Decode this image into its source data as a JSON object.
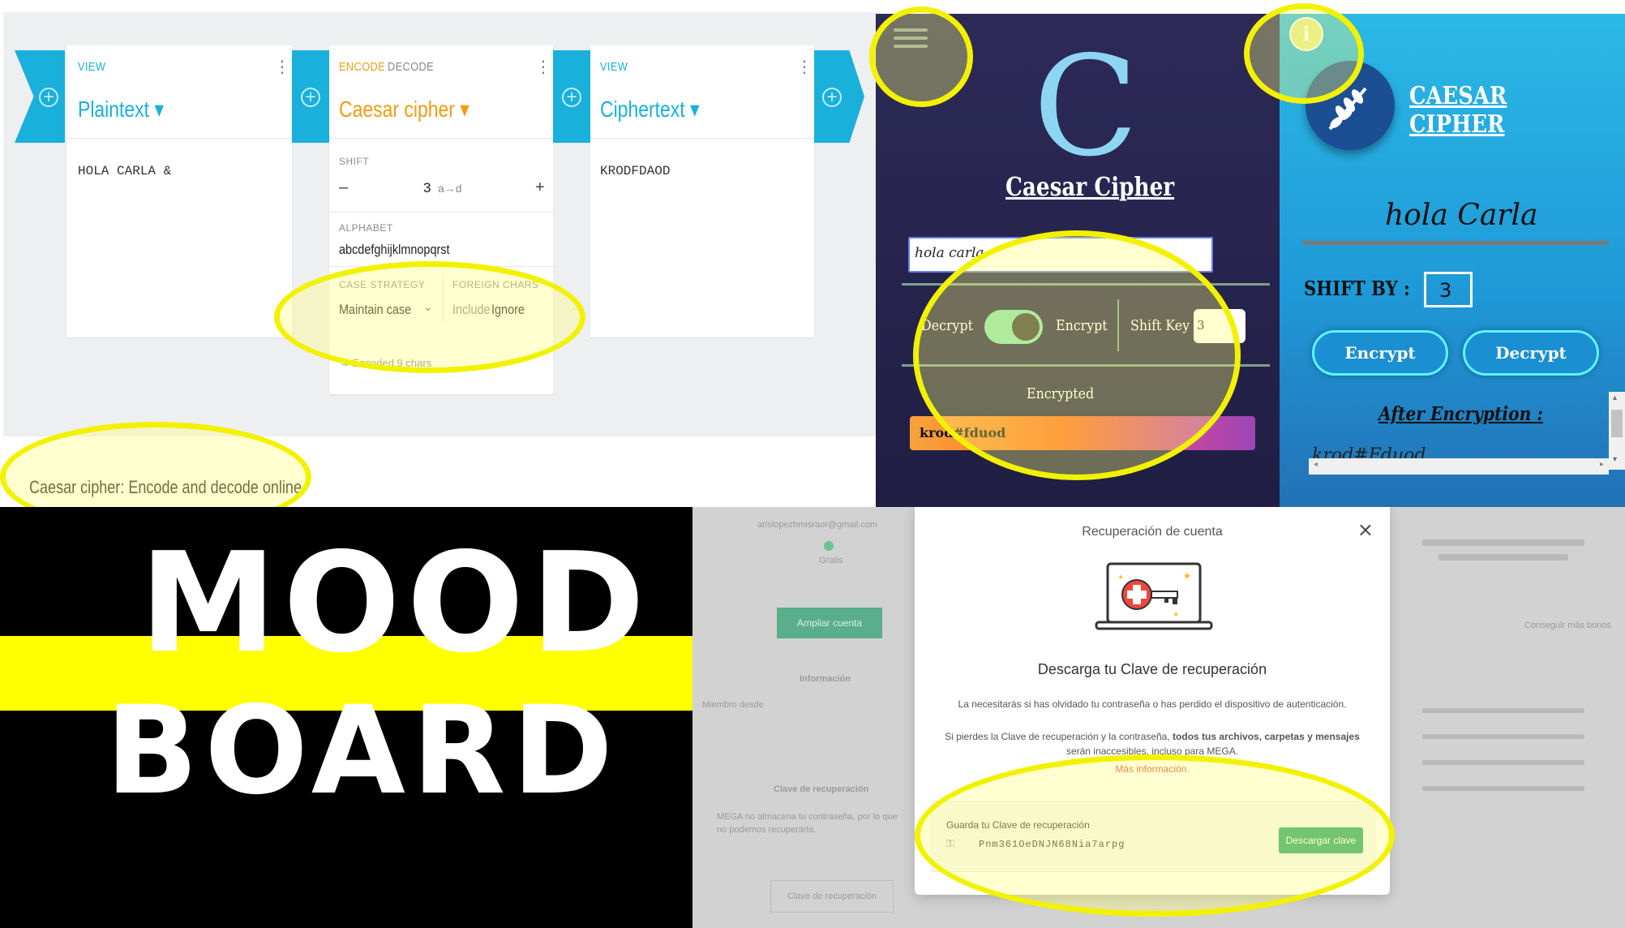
{
  "cryptii": {
    "plaintext_card": {
      "view_label": "VIEW",
      "title": "Plaintext ▾",
      "content": "HOLA CARLA &"
    },
    "caesar_card": {
      "tab_encode": "ENCODE",
      "tab_decode": "DECODE",
      "title": "Caesar cipher ▾",
      "shift_label": "SHIFT",
      "shift_minus": "–",
      "shift_value": "3",
      "shift_mapping": "a→d",
      "shift_plus": "+",
      "alphabet_label": "ALPHABET",
      "alphabet_value": "abcdefghijklmnopqrst",
      "case_label": "CASE STRATEGY",
      "case_value": "Maintain case",
      "foreign_label": "FOREIGN CHARS",
      "foreign_include": "Include",
      "foreign_ignore": "Ignore",
      "footer": "Encoded 9 chars"
    },
    "ciphertext_card": {
      "view_label": "VIEW",
      "title": "Ciphertext ▾",
      "content": "KRODFDAOD"
    },
    "caption": "Caesar cipher: Encode and decode online"
  },
  "dark_app": {
    "logo_letter": "C",
    "title": "Caesar Cipher",
    "input_value": "hola carla",
    "toggle_left": "Decrypt",
    "toggle_right": "Encrypt",
    "shift_label": "Shift Key",
    "shift_value": "3",
    "result_label": "Encrypted",
    "result_value": "krod#fduod",
    "toggle_state": "on"
  },
  "blue_app": {
    "info_icon": "i",
    "title": "CAESAR CIPHER",
    "word": "hola Carla",
    "shift_label": "SHIFT BY :",
    "shift_value": "3",
    "encrypt_button": "Encrypt",
    "decrypt_button": "Decrypt",
    "after_label": "After Encryption :",
    "result": "krod#Fduod"
  },
  "mood_board": {
    "line1": "MOOD",
    "line2": "BOARD"
  },
  "mega": {
    "modal_title": "Recuperación de cuenta",
    "close": "×",
    "heading": "Descarga tu Clave de recuperación",
    "p1": "La necesitarás si has olvidado tu contraseña o has perdido el dispositivo de autenticación.",
    "p2_prefix": "Si pierdes la Clave de recuperación y la contraseña, ",
    "p2_bold": "todos tus archivos, carpetas y mensajes",
    "p2_suffix": " serán inaccesibles, incluso para MEGA.",
    "more_link": "Más información.",
    "key_label": "Guarda tu Clave de recuperación",
    "key_value": "Pnm361OeDNJN68Nia7arpg",
    "download_button": "Descargar clave",
    "bg_email": "arislopezhmisraor@gmail.com",
    "bg_status": "Gratis",
    "bg_upgrade_button": "Ampliar cuenta",
    "bg_info_header": "Información",
    "bg_member_since": "Miembro desde",
    "bg_recovery_header": "Clave de recuperación",
    "bg_recovery_text": "MEGA no almacena tu contraseña, por lo que no podemos recuperarla.",
    "bg_recovery_button": "Clave de recuperación",
    "bg_get_more": "Conseguir más bonos"
  },
  "colors": {
    "highlight_yellow": "#f2f200",
    "cryptii_blue": "#19b0dc",
    "cryptii_orange": "#f39c12",
    "mega_green": "#2aa56d"
  }
}
